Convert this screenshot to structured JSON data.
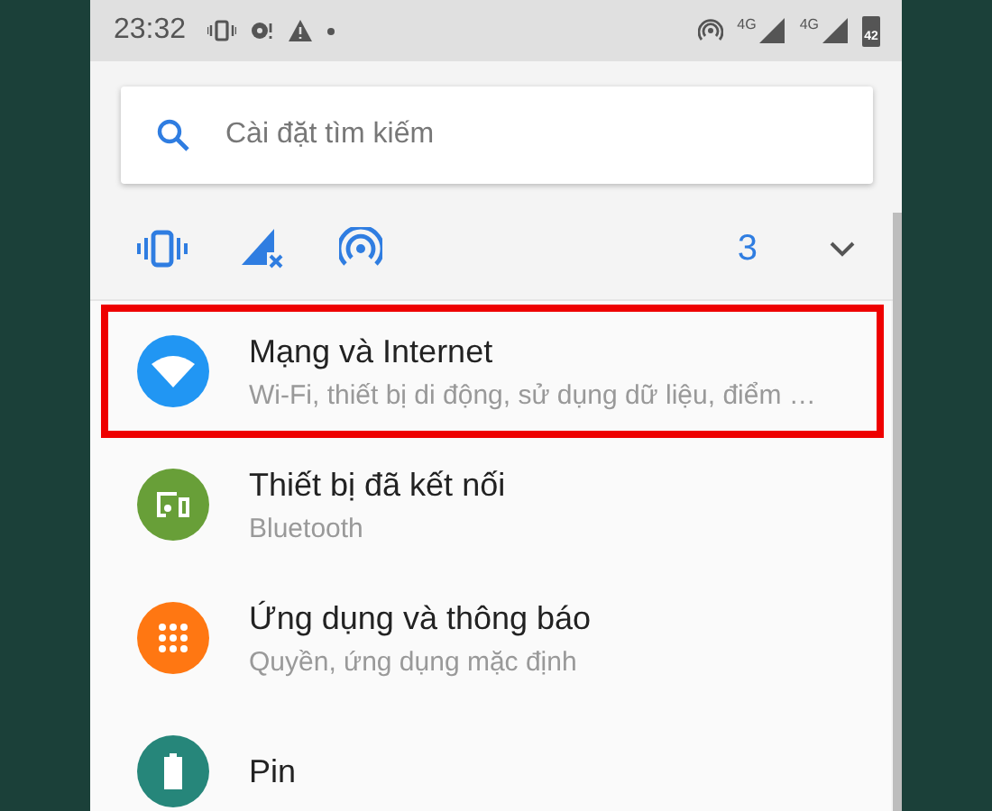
{
  "status_bar": {
    "time": "23:32",
    "network_labels": [
      "4G",
      "4G"
    ],
    "battery": "42"
  },
  "search": {
    "placeholder": "Cài đặt tìm kiếm"
  },
  "conditions": {
    "count": "3",
    "expanded": false
  },
  "items": [
    {
      "title": "Mạng và Internet",
      "subtitle": "Wi-Fi, thiết bị di động, sử dụng dữ liệu, điểm …",
      "kind": "wifi",
      "color": "#2196f3",
      "highlighted": true
    },
    {
      "title": "Thiết bị đã kết nối",
      "subtitle": "Bluetooth",
      "kind": "devices",
      "color": "#689f38",
      "highlighted": false
    },
    {
      "title": "Ứng dụng và thông báo",
      "subtitle": "Quyền, ứng dụng mặc định",
      "kind": "apps",
      "color": "#ff7712",
      "highlighted": false
    },
    {
      "title": "Pin",
      "kind": "battery",
      "color": "#26867a",
      "highlighted": false
    }
  ]
}
